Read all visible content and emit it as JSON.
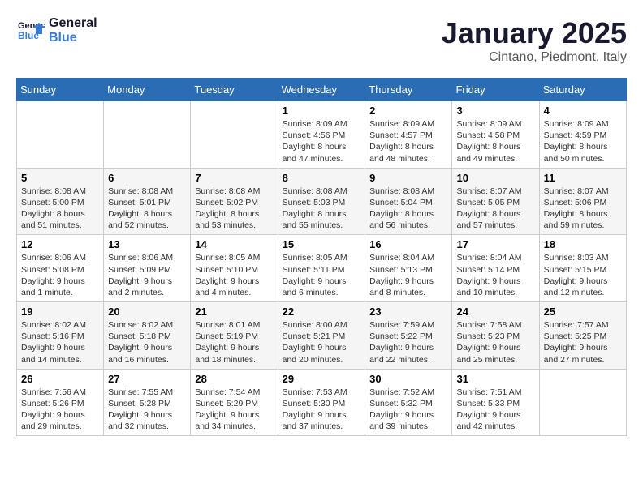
{
  "header": {
    "logo_line1": "General",
    "logo_line2": "Blue",
    "month_title": "January 2025",
    "location": "Cintano, Piedmont, Italy"
  },
  "weekdays": [
    "Sunday",
    "Monday",
    "Tuesday",
    "Wednesday",
    "Thursday",
    "Friday",
    "Saturday"
  ],
  "weeks": [
    [
      {
        "day": "",
        "info": ""
      },
      {
        "day": "",
        "info": ""
      },
      {
        "day": "",
        "info": ""
      },
      {
        "day": "1",
        "info": "Sunrise: 8:09 AM\nSunset: 4:56 PM\nDaylight: 8 hours and 47 minutes."
      },
      {
        "day": "2",
        "info": "Sunrise: 8:09 AM\nSunset: 4:57 PM\nDaylight: 8 hours and 48 minutes."
      },
      {
        "day": "3",
        "info": "Sunrise: 8:09 AM\nSunset: 4:58 PM\nDaylight: 8 hours and 49 minutes."
      },
      {
        "day": "4",
        "info": "Sunrise: 8:09 AM\nSunset: 4:59 PM\nDaylight: 8 hours and 50 minutes."
      }
    ],
    [
      {
        "day": "5",
        "info": "Sunrise: 8:08 AM\nSunset: 5:00 PM\nDaylight: 8 hours and 51 minutes."
      },
      {
        "day": "6",
        "info": "Sunrise: 8:08 AM\nSunset: 5:01 PM\nDaylight: 8 hours and 52 minutes."
      },
      {
        "day": "7",
        "info": "Sunrise: 8:08 AM\nSunset: 5:02 PM\nDaylight: 8 hours and 53 minutes."
      },
      {
        "day": "8",
        "info": "Sunrise: 8:08 AM\nSunset: 5:03 PM\nDaylight: 8 hours and 55 minutes."
      },
      {
        "day": "9",
        "info": "Sunrise: 8:08 AM\nSunset: 5:04 PM\nDaylight: 8 hours and 56 minutes."
      },
      {
        "day": "10",
        "info": "Sunrise: 8:07 AM\nSunset: 5:05 PM\nDaylight: 8 hours and 57 minutes."
      },
      {
        "day": "11",
        "info": "Sunrise: 8:07 AM\nSunset: 5:06 PM\nDaylight: 8 hours and 59 minutes."
      }
    ],
    [
      {
        "day": "12",
        "info": "Sunrise: 8:06 AM\nSunset: 5:08 PM\nDaylight: 9 hours and 1 minute."
      },
      {
        "day": "13",
        "info": "Sunrise: 8:06 AM\nSunset: 5:09 PM\nDaylight: 9 hours and 2 minutes."
      },
      {
        "day": "14",
        "info": "Sunrise: 8:05 AM\nSunset: 5:10 PM\nDaylight: 9 hours and 4 minutes."
      },
      {
        "day": "15",
        "info": "Sunrise: 8:05 AM\nSunset: 5:11 PM\nDaylight: 9 hours and 6 minutes."
      },
      {
        "day": "16",
        "info": "Sunrise: 8:04 AM\nSunset: 5:13 PM\nDaylight: 9 hours and 8 minutes."
      },
      {
        "day": "17",
        "info": "Sunrise: 8:04 AM\nSunset: 5:14 PM\nDaylight: 9 hours and 10 minutes."
      },
      {
        "day": "18",
        "info": "Sunrise: 8:03 AM\nSunset: 5:15 PM\nDaylight: 9 hours and 12 minutes."
      }
    ],
    [
      {
        "day": "19",
        "info": "Sunrise: 8:02 AM\nSunset: 5:16 PM\nDaylight: 9 hours and 14 minutes."
      },
      {
        "day": "20",
        "info": "Sunrise: 8:02 AM\nSunset: 5:18 PM\nDaylight: 9 hours and 16 minutes."
      },
      {
        "day": "21",
        "info": "Sunrise: 8:01 AM\nSunset: 5:19 PM\nDaylight: 9 hours and 18 minutes."
      },
      {
        "day": "22",
        "info": "Sunrise: 8:00 AM\nSunset: 5:21 PM\nDaylight: 9 hours and 20 minutes."
      },
      {
        "day": "23",
        "info": "Sunrise: 7:59 AM\nSunset: 5:22 PM\nDaylight: 9 hours and 22 minutes."
      },
      {
        "day": "24",
        "info": "Sunrise: 7:58 AM\nSunset: 5:23 PM\nDaylight: 9 hours and 25 minutes."
      },
      {
        "day": "25",
        "info": "Sunrise: 7:57 AM\nSunset: 5:25 PM\nDaylight: 9 hours and 27 minutes."
      }
    ],
    [
      {
        "day": "26",
        "info": "Sunrise: 7:56 AM\nSunset: 5:26 PM\nDaylight: 9 hours and 29 minutes."
      },
      {
        "day": "27",
        "info": "Sunrise: 7:55 AM\nSunset: 5:28 PM\nDaylight: 9 hours and 32 minutes."
      },
      {
        "day": "28",
        "info": "Sunrise: 7:54 AM\nSunset: 5:29 PM\nDaylight: 9 hours and 34 minutes."
      },
      {
        "day": "29",
        "info": "Sunrise: 7:53 AM\nSunset: 5:30 PM\nDaylight: 9 hours and 37 minutes."
      },
      {
        "day": "30",
        "info": "Sunrise: 7:52 AM\nSunset: 5:32 PM\nDaylight: 9 hours and 39 minutes."
      },
      {
        "day": "31",
        "info": "Sunrise: 7:51 AM\nSunset: 5:33 PM\nDaylight: 9 hours and 42 minutes."
      },
      {
        "day": "",
        "info": ""
      }
    ]
  ]
}
